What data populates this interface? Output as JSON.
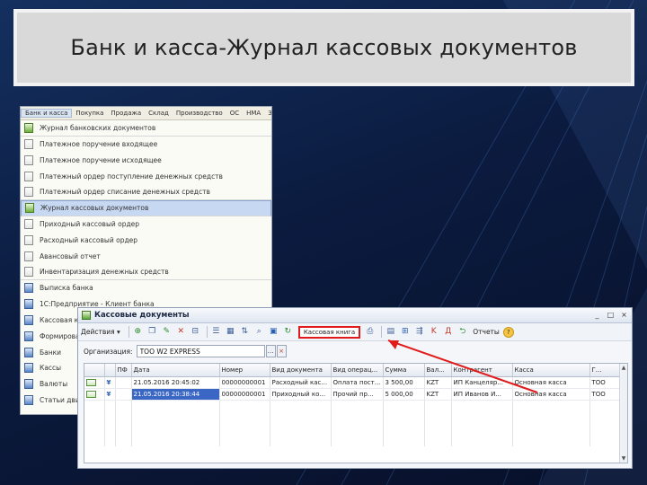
{
  "slide": {
    "title": "Банк и касса-Журнал кассовых документов"
  },
  "menu_window": {
    "menubar": [
      {
        "label": "Банк и касса",
        "active": true
      },
      {
        "label": "Покупка",
        "active": false
      },
      {
        "label": "Продажа",
        "active": false
      },
      {
        "label": "Склад",
        "active": false
      },
      {
        "label": "Производство",
        "active": false
      },
      {
        "label": "ОС",
        "active": false
      },
      {
        "label": "НМА",
        "active": false
      },
      {
        "label": "Зарплата",
        "active": false
      }
    ],
    "items": [
      {
        "label": "Журнал банковских документов",
        "icon": "journal-icon",
        "sep": true
      },
      {
        "label": "Платежное поручение входящее",
        "icon": "document-icon"
      },
      {
        "label": "Платежное поручение исходящее",
        "icon": "document-icon"
      },
      {
        "label": "Платежный ордер поступление денежных средств",
        "icon": "document-icon"
      },
      {
        "label": "Платежный ордер списание денежных средств",
        "icon": "document-icon",
        "sep": true
      },
      {
        "label": "Журнал кассовых документов",
        "icon": "journal-icon",
        "selected": true,
        "sep": true
      },
      {
        "label": "Приходный кассовый ордер",
        "icon": "document-icon"
      },
      {
        "label": "Расходный кассовый ордер",
        "icon": "document-icon"
      },
      {
        "label": "Авансовый отчет",
        "icon": "document-icon"
      },
      {
        "label": "Инвентаризация денежных средств",
        "icon": "document-icon",
        "sep": true
      },
      {
        "label": "Выписка банка",
        "icon": "bank-statement-icon"
      },
      {
        "label": "1С:Предприятие - Клиент банка",
        "icon": "client-bank-icon"
      },
      {
        "label": "Кассовая книга",
        "icon": "cash-book-icon"
      },
      {
        "label": "Формирование...",
        "icon": "form-icon"
      },
      {
        "label": "Банки",
        "icon": "banks-icon"
      },
      {
        "label": "Кассы",
        "icon": "cash-desks-icon"
      },
      {
        "label": "Валюты",
        "icon": "currencies-icon"
      },
      {
        "label": "Статьи движения денежных средств",
        "icon": "cash-flow-icon"
      }
    ]
  },
  "docs_window": {
    "title": "Кассовые документы",
    "controls": [
      "_",
      "□",
      "×"
    ],
    "toolbar": {
      "actions_label": "Действия",
      "highlighted_button": "Кассовая книга",
      "reports_label": "Отчеты"
    },
    "organization_label": "Организация:",
    "organization_value": "ТОО W2 EXPRESS",
    "table": {
      "columns": [
        "",
        "",
        "ПФ",
        "Дата",
        "Номер",
        "Вид документа",
        "Вид операц...",
        "Сумма",
        "Вал...",
        "Контрагент",
        "Касса",
        "Г..."
      ],
      "rows": [
        [
          "",
          "",
          "",
          "21.05.2016 20:45:02",
          "00000000001",
          "Расходный кас...",
          "Оплата пост...",
          "3 500,00",
          "KZT",
          "ИП Канцеляр...",
          "Основная касса",
          "ТОО"
        ],
        [
          "",
          "",
          "",
          "21.05.2016 20:38:44",
          "00000000001",
          "Приходный ко...",
          "Прочий пр...",
          "5 000,00",
          "KZT",
          "ИП Иванов И...",
          "Основная касса",
          "ТОО"
        ]
      ]
    }
  },
  "colors": {
    "highlight_box": "#e11b1b",
    "selection": "#3a66c4"
  }
}
